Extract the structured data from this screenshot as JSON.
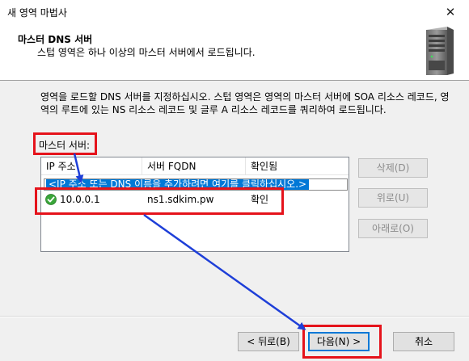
{
  "window": {
    "title": "새 영역 마법사",
    "close_glyph": "✕"
  },
  "header": {
    "title": "마스터 DNS 서버",
    "subtitle": "스텁 영역은 하나 이상의 마스터 서버에서 로드됩니다."
  },
  "description": "영역을 로드할 DNS 서버를 지정하십시오. 스텁 영역은 영역의 마스터 서버에 SOA 리소스 레코드, 영역의 루트에 있는 NS 리소스 레코드 및 글루 A 리소스 레코드를 쿼리하여 로드됩니다.",
  "master_servers": {
    "label": "마스터 서버:",
    "columns": [
      "IP 주소",
      "서버 FQDN",
      "확인됨"
    ],
    "edit_placeholder": "<IP 주소 또는 DNS 이름을 추가하려면 여기를 클릭하십시오.>",
    "rows": [
      {
        "ip": "10.0.0.1",
        "fqdn": "ns1.sdkim.pw",
        "verified": "확인",
        "status_icon": "check-icon"
      }
    ]
  },
  "side_buttons": {
    "delete": "삭제(D)",
    "up": "위로(U)",
    "down": "아래로(O)"
  },
  "footer": {
    "back": "< 뒤로(B)",
    "next": "다음(N) >",
    "cancel": "취소"
  },
  "colors": {
    "annotation": "#e5131b",
    "arrow": "#1e3fd8",
    "selection": "#0078d7",
    "check": "#3aa63a"
  }
}
